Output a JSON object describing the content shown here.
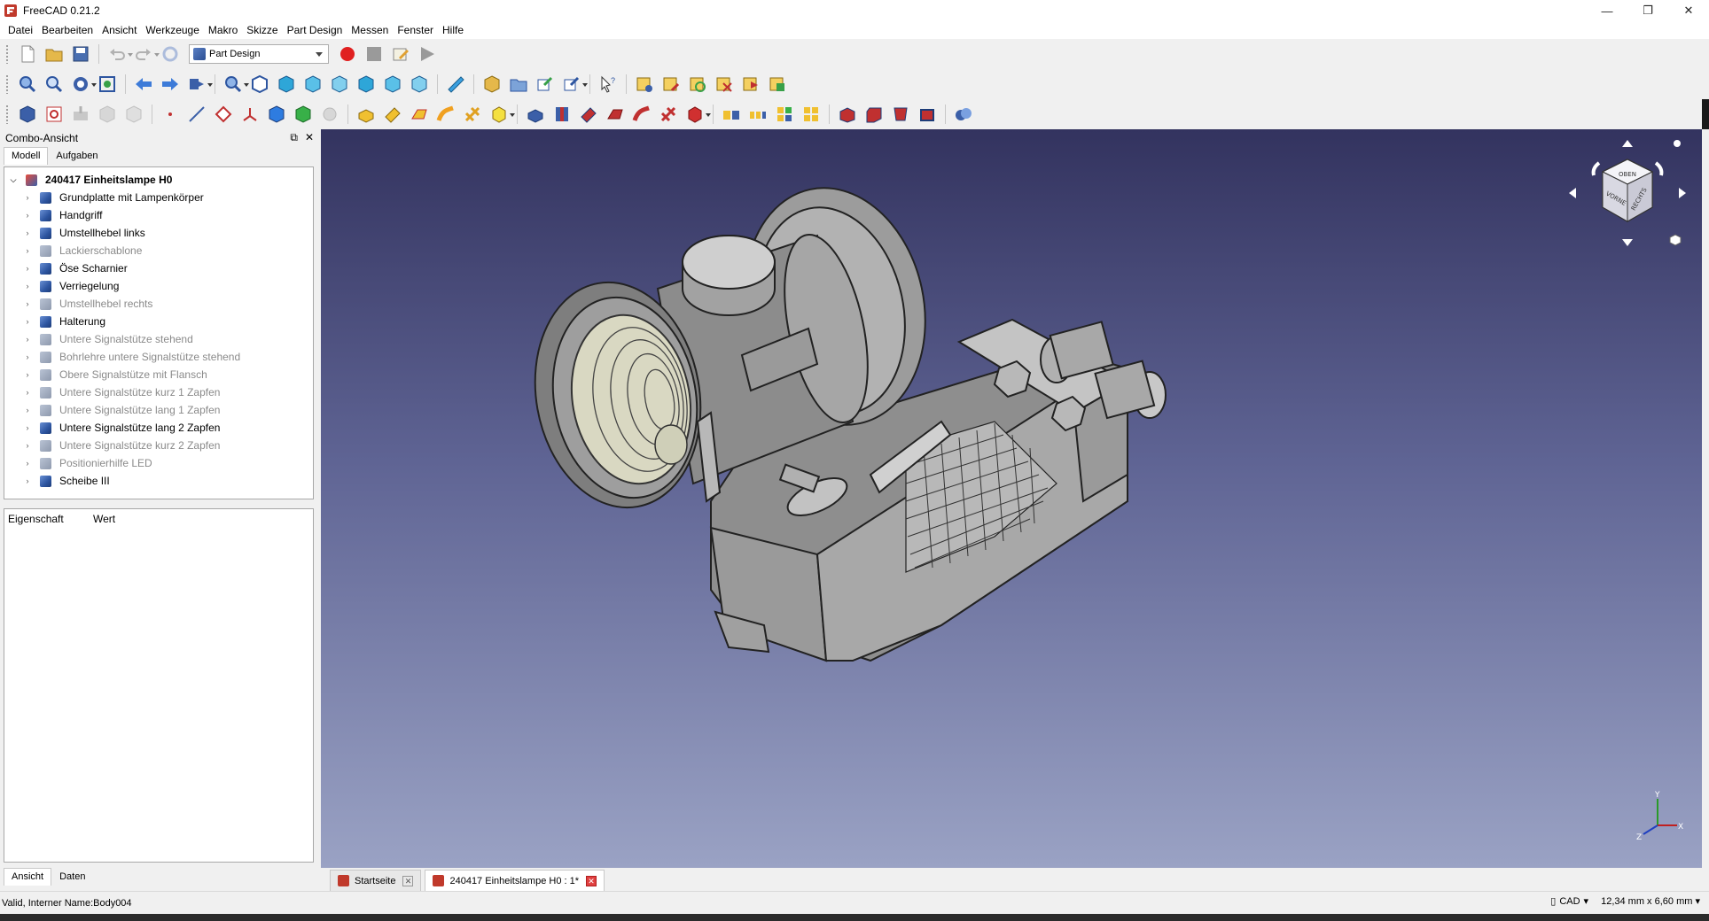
{
  "window": {
    "title": "FreeCAD 0.21.2",
    "minimize": "—",
    "maximize": "❐",
    "close": "✕"
  },
  "menu": [
    "Datei",
    "Bearbeiten",
    "Ansicht",
    "Werkzeuge",
    "Makro",
    "Skizze",
    "Part Design",
    "Messen",
    "Fenster",
    "Hilfe"
  ],
  "workbench": {
    "selected": "Part Design"
  },
  "combo": {
    "title": "Combo-Ansicht",
    "tabs": [
      "Modell",
      "Aufgaben"
    ],
    "bottom_tabs": [
      "Ansicht",
      "Daten"
    ],
    "props_headers": [
      "Eigenschaft",
      "Wert"
    ],
    "tree_root": "240417 Einheitslampe H0",
    "tree_items": [
      {
        "label": "Grundplatte mit Lampenkörper",
        "visible": true
      },
      {
        "label": "Handgriff",
        "visible": true
      },
      {
        "label": "Umstellhebel links",
        "visible": true
      },
      {
        "label": "Lackierschablone",
        "visible": false
      },
      {
        "label": "Öse Scharnier",
        "visible": true
      },
      {
        "label": "Verriegelung",
        "visible": true
      },
      {
        "label": "Umstellhebel rechts",
        "visible": false
      },
      {
        "label": "Halterung",
        "visible": true
      },
      {
        "label": "Untere Signalstütze stehend",
        "visible": false
      },
      {
        "label": "Bohrlehre untere Signalstütze stehend",
        "visible": false
      },
      {
        "label": "Obere Signalstütze mit Flansch",
        "visible": false
      },
      {
        "label": "Untere Signalstütze kurz 1 Zapfen",
        "visible": false
      },
      {
        "label": "Untere Signalstütze lang 1 Zapfen",
        "visible": false
      },
      {
        "label": "Untere Signalstütze lang 2 Zapfen",
        "visible": true
      },
      {
        "label": "Untere Signalstütze kurz 2 Zapfen",
        "visible": false
      },
      {
        "label": "Positionierhilfe LED",
        "visible": false
      },
      {
        "label": "Scheibe III",
        "visible": true
      }
    ]
  },
  "doc_tabs": [
    {
      "label": "Startseite",
      "active": false
    },
    {
      "label": "240417 Einheitslampe H0 : 1*",
      "active": true
    }
  ],
  "navcube": {
    "faces": [
      "OBEN",
      "VORNE",
      "RECHTS"
    ]
  },
  "axis": {
    "x": "X",
    "y": "Y",
    "z": "Z"
  },
  "status": {
    "message": "Valid, Interner Name:Body004",
    "nav_style": "CAD",
    "dimensions": "12,34 mm x 6,60 mm"
  },
  "colors": {
    "record": "#e02020",
    "accent": "#2d55a0",
    "bg_top": "#33335f",
    "bg_bottom": "#9aa2c4"
  }
}
